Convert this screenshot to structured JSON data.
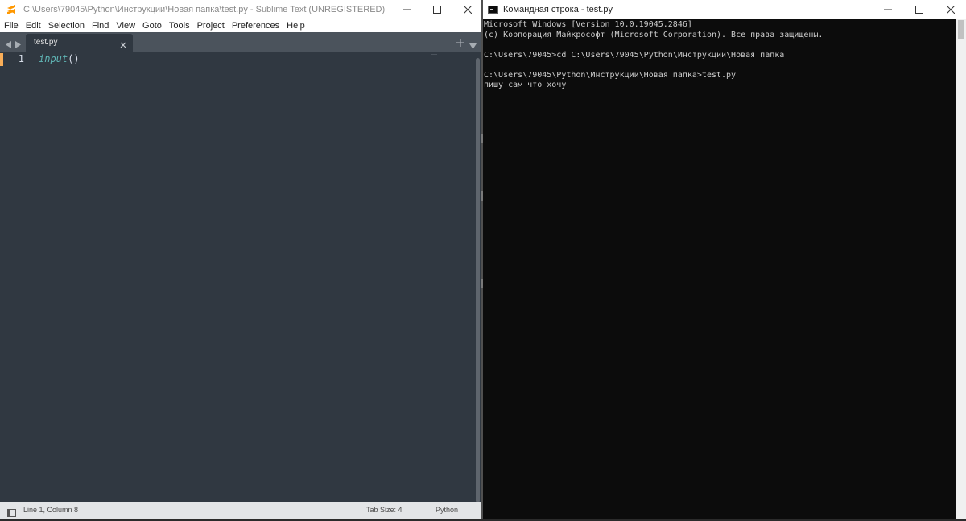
{
  "sublime": {
    "title": "C:\\Users\\79045\\Python\\Инструкции\\Новая папка\\test.py - Sublime Text (UNREGISTERED)",
    "menu": [
      "File",
      "Edit",
      "Selection",
      "Find",
      "View",
      "Goto",
      "Tools",
      "Project",
      "Preferences",
      "Help"
    ],
    "tab": {
      "label": "test.py"
    },
    "line_number": "1",
    "code": {
      "function": "input",
      "parens": "()"
    },
    "status": {
      "position": "Line 1, Column 8",
      "tab_size": "Tab Size: 4",
      "syntax": "Python"
    },
    "colors": {
      "bg": "#303841",
      "tabbar": "#4b535c",
      "function": "#5fb4b4",
      "line_marker": "#f9ae58"
    }
  },
  "cmd": {
    "title": "Командная строка - test.py",
    "lines": [
      "Microsoft Windows [Version 10.0.19045.2846]",
      "(c) Корпорация Майкрософт (Microsoft Corporation). Все права защищены.",
      "",
      "C:\\Users\\79045>cd C:\\Users\\79045\\Python\\Инструкции\\Новая папка",
      "",
      "C:\\Users\\79045\\Python\\Инструкции\\Новая папка>test.py",
      "пишу сам что хочу"
    ]
  }
}
